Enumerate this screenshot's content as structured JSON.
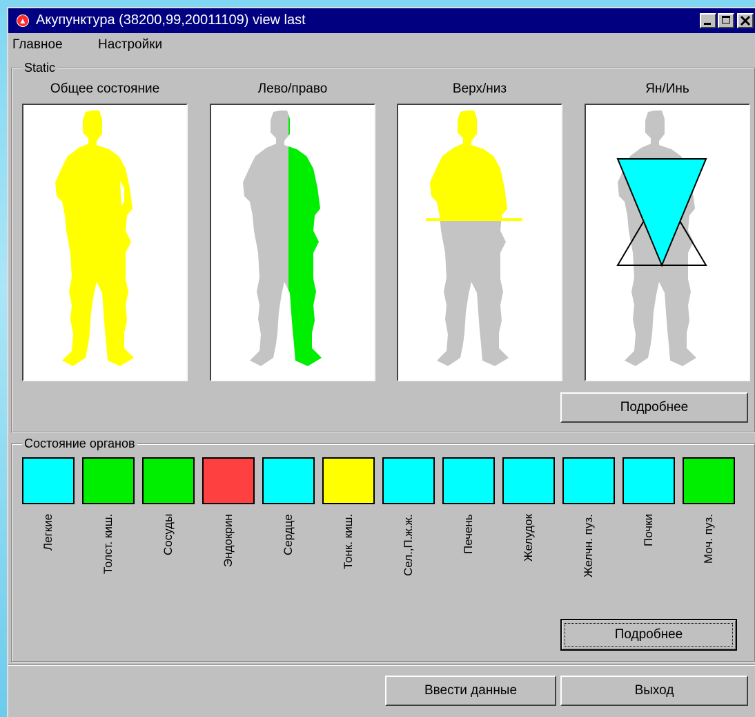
{
  "window": {
    "title": "Акупунктура (38200,99,20011109) view last",
    "app_icon_glyph": "▲",
    "controls": [
      "minimize-icon",
      "maximize-icon",
      "close-icon"
    ]
  },
  "menu": {
    "items": [
      "Главное",
      "Настройки"
    ]
  },
  "static_group": {
    "title": "Static",
    "figures": [
      {
        "label": "Общее состояние",
        "mode": "whole",
        "color": "#ffff00"
      },
      {
        "label": "Лево/право",
        "mode": "right-half",
        "color": "#00ee00"
      },
      {
        "label": "Верх/низ",
        "mode": "upper-half",
        "color": "#ffff00"
      },
      {
        "label": "Ян/Инь",
        "mode": "yin-yang",
        "color": "#00ffff"
      }
    ],
    "details_button": "Подробнее"
  },
  "organs_group": {
    "title": "Состояние органов",
    "items": [
      {
        "label": "Легкие",
        "color": "#00ffff"
      },
      {
        "label": "Толст. киш.",
        "color": "#00ee00"
      },
      {
        "label": "Сосуды",
        "color": "#00ee00"
      },
      {
        "label": "Эндокрин",
        "color": "#ff4040"
      },
      {
        "label": "Сердце",
        "color": "#00ffff"
      },
      {
        "label": "Тонк. киш.",
        "color": "#ffff00"
      },
      {
        "label": "Сел.,П.ж.ж.",
        "color": "#00ffff"
      },
      {
        "label": "Печень",
        "color": "#00ffff"
      },
      {
        "label": "Желудок",
        "color": "#00ffff"
      },
      {
        "label": "Желчн. пуз.",
        "color": "#00ffff"
      },
      {
        "label": "Почки",
        "color": "#00ffff"
      },
      {
        "label": "Моч. пуз.",
        "color": "#00ee00"
      }
    ],
    "details_button": "Подробнее"
  },
  "footer": {
    "enter_data_button": "Ввести данные",
    "exit_button": "Выход"
  },
  "colors": {
    "body_gray": "#c0c0c0",
    "titlebar": "#000080"
  }
}
